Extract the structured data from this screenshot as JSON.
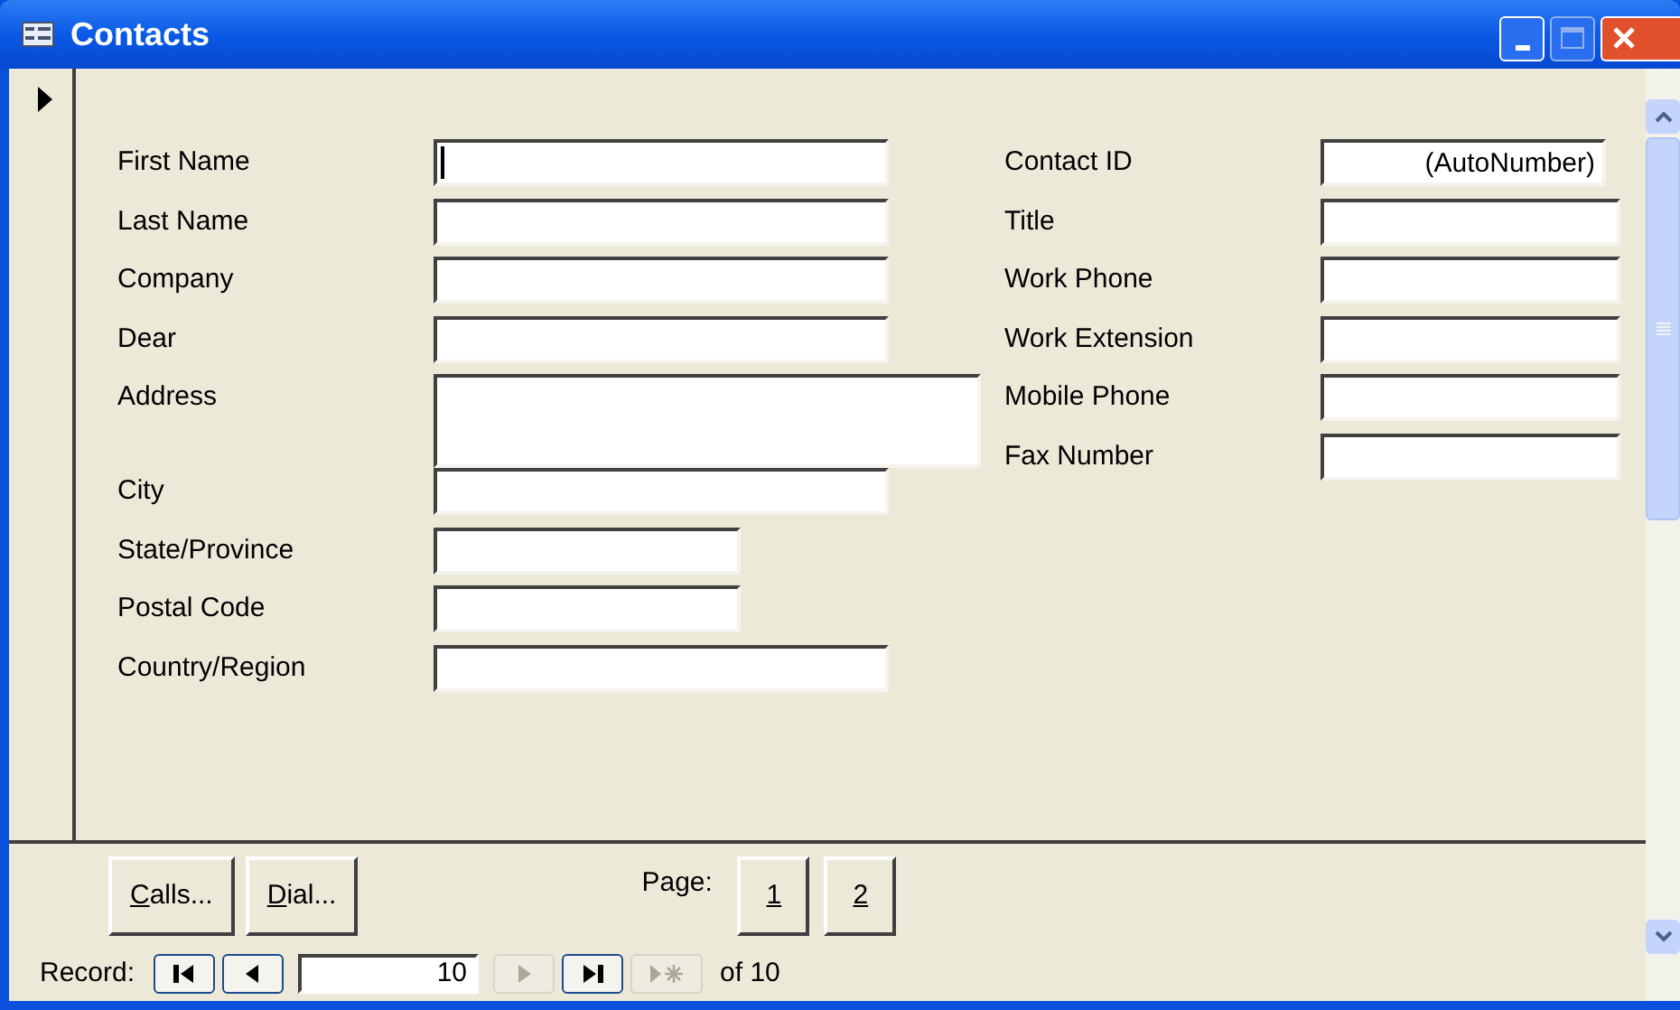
{
  "window": {
    "title": "Contacts"
  },
  "left_fields": [
    {
      "label": "First Name",
      "kind": "text",
      "focused": true
    },
    {
      "label": "Last Name",
      "kind": "text",
      "focused": false
    },
    {
      "label": "Company",
      "kind": "text",
      "focused": false
    },
    {
      "label": "Dear",
      "kind": "text",
      "focused": false
    },
    {
      "label": "Address",
      "kind": "memo",
      "focused": false
    },
    {
      "label": "City",
      "kind": "text",
      "focused": false
    },
    {
      "label": "State/Province",
      "kind": "short",
      "focused": false
    },
    {
      "label": "Postal Code",
      "kind": "short",
      "focused": false
    },
    {
      "label": "Country/Region",
      "kind": "text",
      "focused": false
    }
  ],
  "right_fields": [
    {
      "label": "Contact ID",
      "value": "(AutoNumber)",
      "kind": "auto",
      "focused": false
    },
    {
      "label": "Title",
      "kind": "text",
      "focused": false
    },
    {
      "label": "Work Phone",
      "kind": "text",
      "focused": false
    },
    {
      "label": "Work Extension",
      "kind": "text",
      "focused": false
    },
    {
      "label": "Mobile Phone",
      "kind": "text",
      "focused": false
    },
    {
      "label": "Fax Number",
      "kind": "text",
      "focused": false
    }
  ],
  "footer": {
    "buttons": [
      {
        "mnemonic": "C",
        "rest": "alls..."
      },
      {
        "mnemonic": "D",
        "rest": "ial..."
      }
    ],
    "page_label": "Page:",
    "pages": [
      "1",
      "2"
    ]
  },
  "navigation": {
    "label": "Record:",
    "current": "10",
    "total": "of 10",
    "buttons": [
      {
        "kind": "first",
        "disabled": false
      },
      {
        "kind": "prev",
        "disabled": false
      },
      {
        "kind": "input"
      },
      {
        "kind": "next",
        "disabled": true
      },
      {
        "kind": "last",
        "disabled": false
      },
      {
        "kind": "new",
        "disabled": true
      }
    ]
  }
}
